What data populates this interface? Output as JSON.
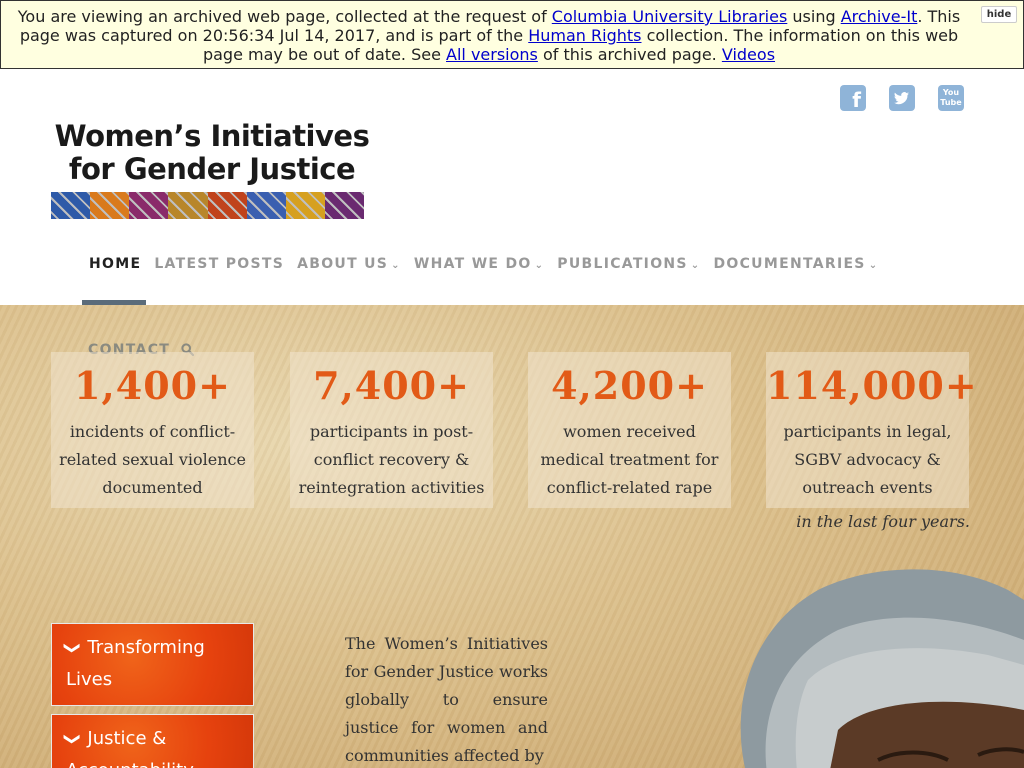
{
  "banner": {
    "text_1": "You are viewing an archived web page, collected at the request of ",
    "link_columbia": "Columbia University Libraries",
    "text_2": " using ",
    "link_archiveit": "Archive-It",
    "text_3": ". This page was captured on 20:56:34 Jul 14, 2017, and is part of the ",
    "link_collection": "Human Rights",
    "text_4": " collection. The information on this web page may be out of date. See ",
    "link_versions": "All versions",
    "text_5": " of this archived page. ",
    "link_videos": "Videos",
    "hide_label": "hide"
  },
  "social": {
    "facebook": "f",
    "twitter": "t",
    "youtube": "You Tube"
  },
  "logo": {
    "line1": "Women’s Initiatives",
    "line2": "for Gender Justice",
    "strip_colors": [
      "#2e5aa8",
      "#d97a1c",
      "#8a2a6a",
      "#b8862a",
      "#c0431c",
      "#3a5fb0",
      "#d6a020",
      "#6a2a70"
    ]
  },
  "nav": {
    "home": "HOME",
    "latest": "LATEST POSTS",
    "about": "ABOUT US",
    "what": "WHAT WE DO",
    "publications": "PUBLICATIONS",
    "documentaries": "DOCUMENTARIES",
    "contact": "CONTACT"
  },
  "stats": [
    {
      "num": "1,400+",
      "desc": "incidents of conflict-related sexual violence documented"
    },
    {
      "num": "7,400+",
      "desc": "participants in post-conflict recovery & reintegration activities"
    },
    {
      "num": "4,200+",
      "desc": "women received medical treatment for conflict-related rape"
    },
    {
      "num": "114,000+",
      "desc": "participants in legal, SGBV advocacy & outreach events"
    }
  ],
  "tagline": "in the last four years.",
  "sidebar": {
    "item1": "Transforming Lives",
    "item2": "Justice & Accountability"
  },
  "intro": "The Women’s Initiatives for Gender Justice works globally to ensure justice for women and communities affected by",
  "colors": {
    "accent": "#e25a17",
    "nav_active": "#222222",
    "nav_inactive": "#999999"
  }
}
